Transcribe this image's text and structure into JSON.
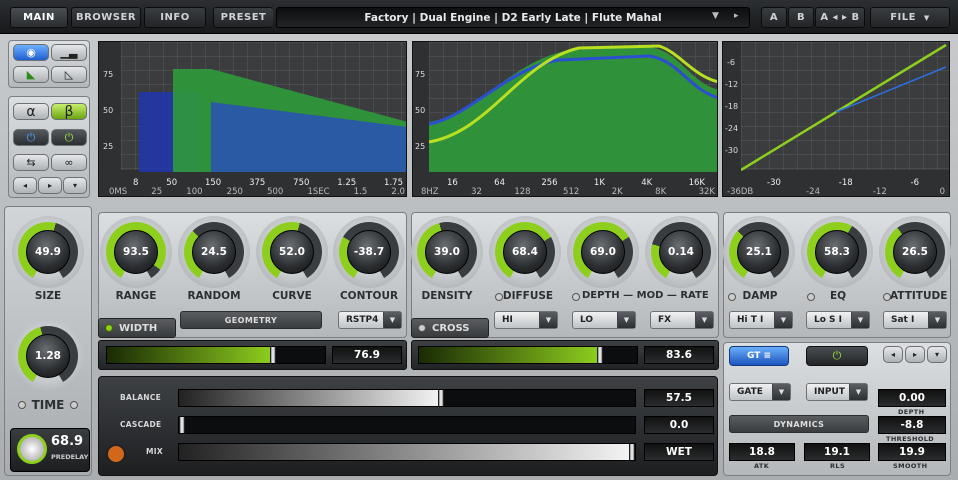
{
  "nav": {
    "main": "MAIN",
    "browser": "BROWSER",
    "info": "INFO"
  },
  "preset": {
    "label": "PRESET",
    "name": "Factory | Dual Engine | D2 Early Late | Flute Mahal"
  },
  "compare": {
    "a": "A",
    "b": "B",
    "a_to_b": "A ◂ ▸ B",
    "file": "FILE"
  },
  "graph_time": {
    "y_ticks": [
      "75",
      "50",
      "25"
    ],
    "x_top": [
      "8",
      "50",
      "150",
      "375",
      "750",
      "1.25",
      "1.75"
    ],
    "x_bottom": [
      "0MS",
      "25",
      "100",
      "250",
      "500",
      "1SEC",
      "1.5",
      "2.0"
    ]
  },
  "graph_freq": {
    "y_ticks": [
      "75",
      "50",
      "25"
    ],
    "x_top": [
      "16",
      "64",
      "256",
      "1K",
      "4K",
      "16K"
    ],
    "x_bottom": [
      "8HZ",
      "32",
      "128",
      "512",
      "2K",
      "8K",
      "32K"
    ]
  },
  "graph_dyn": {
    "y_ticks": [
      "-6",
      "-12",
      "-18",
      "-24",
      "-30"
    ],
    "x_top": [
      "-30",
      "-18",
      "-6"
    ],
    "x_bottom": [
      "-36DB",
      "-24",
      "-12",
      "0"
    ]
  },
  "tools": {
    "alpha": "α",
    "beta": "β"
  },
  "knobs": {
    "size": {
      "label": "SIZE",
      "value": "49.9"
    },
    "time": {
      "label": "TIME",
      "value": "1.28"
    },
    "range": {
      "label": "RANGE",
      "value": "93.5"
    },
    "random": {
      "label": "RANDOM",
      "value": "24.5"
    },
    "curve": {
      "label": "CURVE",
      "value": "52.0"
    },
    "contour": {
      "label": "CONTOUR",
      "value": "-38.7"
    },
    "density": {
      "label": "DENSITY",
      "value": "39.0"
    },
    "diffuse": {
      "label": "DIFFUSE",
      "value": "68.4"
    },
    "depth": {
      "value": "69.0"
    },
    "rate": {
      "value": "0.14"
    },
    "depth_mod_rate_label": "DEPTH — MOD — RATE",
    "damp": {
      "label": "DAMP",
      "value": "25.1"
    },
    "eq": {
      "label": "EQ",
      "value": "58.3"
    },
    "attitude": {
      "label": "ATTITUDE",
      "value": "26.5"
    }
  },
  "geometry_button": "GEOMETRY",
  "dropdowns": {
    "contour": "RSTP4",
    "diffuse": "HI",
    "depth": "LO",
    "rate": "FX",
    "damp": "Hi T I",
    "eq": "Lo S I",
    "attitude": "Sat I",
    "gate": "GATE",
    "input": "INPUT"
  },
  "width": {
    "label": "WIDTH",
    "value": "76.9",
    "level": 0.77
  },
  "cross": {
    "label": "CROSS",
    "value": "83.6",
    "level": 0.84
  },
  "mix": {
    "balance": {
      "label": "BALANCE",
      "value": "57.5",
      "level": 0.575
    },
    "cascade": {
      "label": "CASCADE",
      "value": "0.0",
      "level": 0.0
    },
    "mix": {
      "label": "MIX",
      "value": "WET",
      "level": 1.0
    }
  },
  "predelay": {
    "value": "68.9",
    "label": "PREDELAY"
  },
  "dynamics": {
    "button": "DYNAMICS",
    "depth": {
      "value": "0.00",
      "label": "DEPTH"
    },
    "threshold": {
      "value": "-8.8",
      "label": "THRESHOLD"
    },
    "atk": {
      "value": "18.8",
      "label": "ATK"
    },
    "rls": {
      "value": "19.1",
      "label": "RLS"
    },
    "smooth": {
      "value": "19.9",
      "label": "SMOOTH"
    }
  },
  "colors": {
    "accent_green": "#8ecf1e",
    "blue_curve": "#2b4fd0",
    "panel_dark": "#2a2c2e"
  }
}
